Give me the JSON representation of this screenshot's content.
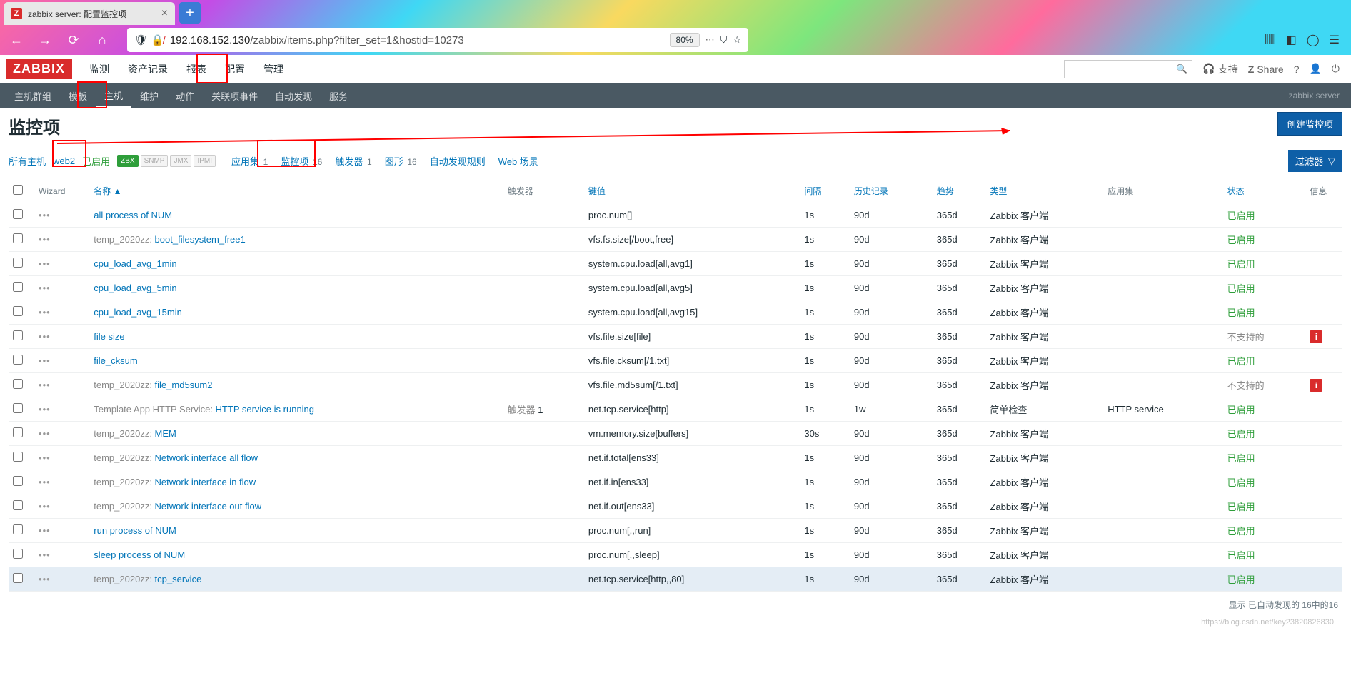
{
  "browser": {
    "tab_title": "zabbix server: 配置监控项",
    "url_host": "192.168.152.130",
    "url_path": "/zabbix/items.php?filter_set=1&hostid=10273",
    "zoom": "80%"
  },
  "header": {
    "logo": "ZABBIX",
    "nav": [
      "监测",
      "资产记录",
      "报表",
      "配置",
      "管理"
    ],
    "active_nav": "配置",
    "support": "支持",
    "share": "Share"
  },
  "subnav": {
    "items": [
      "主机群组",
      "模板",
      "主机",
      "维护",
      "动作",
      "关联项事件",
      "自动发现",
      "服务"
    ],
    "active": "主机",
    "right_label": "zabbix server"
  },
  "page": {
    "title": "监控项",
    "create_btn": "创建监控项",
    "filter_btn": "过滤器",
    "breadcrumb": {
      "all_hosts": "所有主机",
      "host": "web2",
      "enabled": "已启用"
    },
    "badges": [
      "ZBX",
      "SNMP",
      "JMX",
      "IPMI"
    ],
    "tabs": [
      {
        "label": "应用集",
        "count": "1"
      },
      {
        "label": "监控项",
        "count": "16"
      },
      {
        "label": "触发器",
        "count": "1"
      },
      {
        "label": "图形",
        "count": "16"
      },
      {
        "label": "自动发现规则",
        "count": ""
      },
      {
        "label": "Web 场景",
        "count": ""
      }
    ],
    "footer": "显示 已自动发现的 16中的16",
    "watermark": "https://blog.csdn.net/key23820826830"
  },
  "table": {
    "headers": {
      "wizard": "Wizard",
      "name": "名称 ▲",
      "triggers": "触发器",
      "key": "键值",
      "interval": "间隔",
      "history": "历史记录",
      "trends": "趋势",
      "type": "类型",
      "apps": "应用集",
      "status": "状态",
      "info": "信息"
    },
    "rows": [
      {
        "name": "all process of NUM",
        "prefix": "",
        "key": "proc.num[]",
        "int": "1s",
        "hist": "90d",
        "trend": "365d",
        "type": "Zabbix 客户端",
        "app": "",
        "status": "已启用",
        "info": ""
      },
      {
        "name": "boot_filesystem_free1",
        "prefix": "temp_2020zz: ",
        "key": "vfs.fs.size[/boot,free]",
        "int": "1s",
        "hist": "90d",
        "trend": "365d",
        "type": "Zabbix 客户端",
        "app": "",
        "status": "已启用",
        "info": ""
      },
      {
        "name": "cpu_load_avg_1min",
        "prefix": "",
        "key": "system.cpu.load[all,avg1]",
        "int": "1s",
        "hist": "90d",
        "trend": "365d",
        "type": "Zabbix 客户端",
        "app": "",
        "status": "已启用",
        "info": ""
      },
      {
        "name": "cpu_load_avg_5min",
        "prefix": "",
        "key": "system.cpu.load[all,avg5]",
        "int": "1s",
        "hist": "90d",
        "trend": "365d",
        "type": "Zabbix 客户端",
        "app": "",
        "status": "已启用",
        "info": ""
      },
      {
        "name": "cpu_load_avg_15min",
        "prefix": "",
        "key": "system.cpu.load[all,avg15]",
        "int": "1s",
        "hist": "90d",
        "trend": "365d",
        "type": "Zabbix 客户端",
        "app": "",
        "status": "已启用",
        "info": ""
      },
      {
        "name": "file size",
        "prefix": "",
        "key": "vfs.file.size[file]",
        "int": "1s",
        "hist": "90d",
        "trend": "365d",
        "type": "Zabbix 客户端",
        "app": "",
        "status": "不支持的",
        "info": "!"
      },
      {
        "name": "file_cksum",
        "prefix": "",
        "key": "vfs.file.cksum[/1.txt]",
        "int": "1s",
        "hist": "90d",
        "trend": "365d",
        "type": "Zabbix 客户端",
        "app": "",
        "status": "已启用",
        "info": ""
      },
      {
        "name": "file_md5sum2",
        "prefix": "temp_2020zz: ",
        "key": "vfs.file.md5sum[/1.txt]",
        "int": "1s",
        "hist": "90d",
        "trend": "365d",
        "type": "Zabbix 客户端",
        "app": "",
        "status": "不支持的",
        "info": "!"
      },
      {
        "name": "HTTP service is running",
        "prefix": "Template App HTTP Service: ",
        "key": "net.tcp.service[http]",
        "int": "1s",
        "hist": "1w",
        "trend": "365d",
        "type": "简单检查",
        "app": "HTTP service",
        "status": "已启用",
        "info": "",
        "trig": "触发器 1"
      },
      {
        "name": "MEM",
        "prefix": "temp_2020zz: ",
        "key": "vm.memory.size[buffers]",
        "int": "30s",
        "hist": "90d",
        "trend": "365d",
        "type": "Zabbix 客户端",
        "app": "",
        "status": "已启用",
        "info": ""
      },
      {
        "name": "Network interface all flow",
        "prefix": "temp_2020zz: ",
        "key": "net.if.total[ens33]",
        "int": "1s",
        "hist": "90d",
        "trend": "365d",
        "type": "Zabbix 客户端",
        "app": "",
        "status": "已启用",
        "info": ""
      },
      {
        "name": "Network interface in flow",
        "prefix": "temp_2020zz: ",
        "key": "net.if.in[ens33]",
        "int": "1s",
        "hist": "90d",
        "trend": "365d",
        "type": "Zabbix 客户端",
        "app": "",
        "status": "已启用",
        "info": ""
      },
      {
        "name": "Network interface out flow",
        "prefix": "temp_2020zz: ",
        "key": "net.if.out[ens33]",
        "int": "1s",
        "hist": "90d",
        "trend": "365d",
        "type": "Zabbix 客户端",
        "app": "",
        "status": "已启用",
        "info": ""
      },
      {
        "name": "run process of NUM",
        "prefix": "",
        "key": "proc.num[,,run]",
        "int": "1s",
        "hist": "90d",
        "trend": "365d",
        "type": "Zabbix 客户端",
        "app": "",
        "status": "已启用",
        "info": ""
      },
      {
        "name": "sleep process of NUM",
        "prefix": "",
        "key": "proc.num[,,sleep]",
        "int": "1s",
        "hist": "90d",
        "trend": "365d",
        "type": "Zabbix 客户端",
        "app": "",
        "status": "已启用",
        "info": ""
      },
      {
        "name": "tcp_service",
        "prefix": "temp_2020zz: ",
        "key": "net.tcp.service[http,,80]",
        "int": "1s",
        "hist": "90d",
        "trend": "365d",
        "type": "Zabbix 客户端",
        "app": "",
        "status": "已启用",
        "info": "",
        "hl": true
      }
    ]
  }
}
